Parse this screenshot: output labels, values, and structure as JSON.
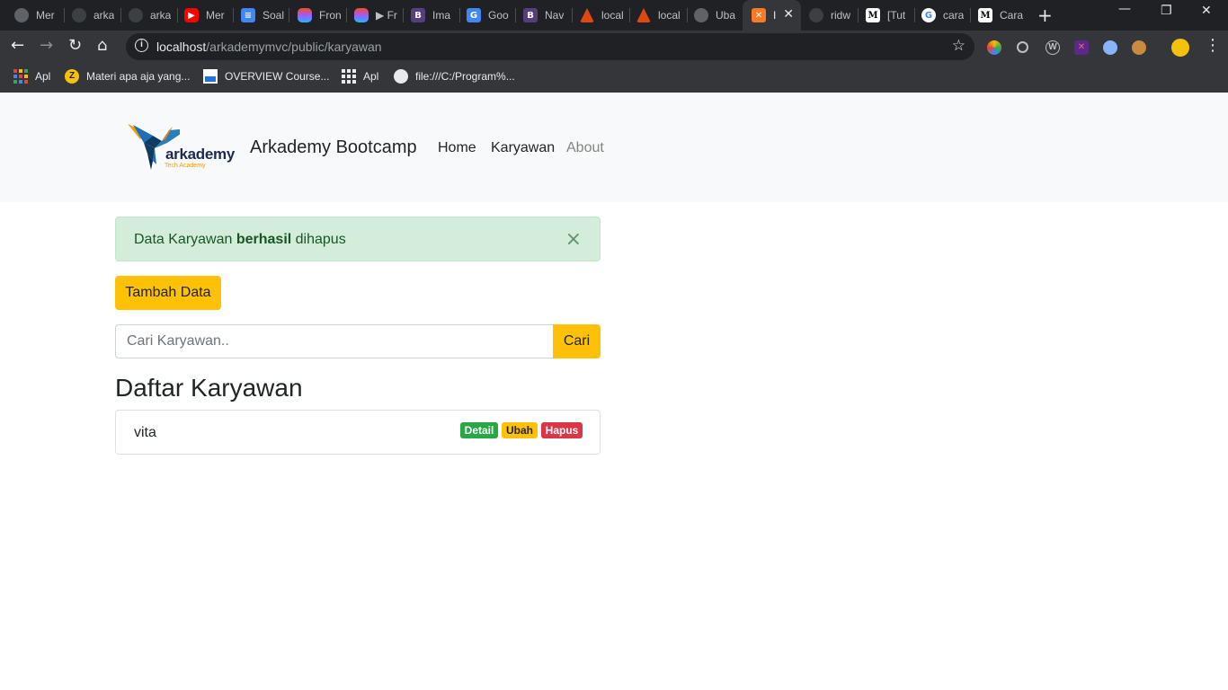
{
  "browser": {
    "tabs": [
      {
        "title": "Mer",
        "icon": "globe-icon"
      },
      {
        "title": "arka",
        "icon": "github-icon"
      },
      {
        "title": "arka",
        "icon": "github-icon"
      },
      {
        "title": "Mer",
        "icon": "youtube-icon"
      },
      {
        "title": "Soal",
        "icon": "docs-icon"
      },
      {
        "title": "Fron",
        "icon": "figma-icon"
      },
      {
        "title": "▶ Fr",
        "icon": "figma-icon"
      },
      {
        "title": "Ima",
        "icon": "bootstrap-icon"
      },
      {
        "title": "Goo",
        "icon": "translate-icon"
      },
      {
        "title": "Nav",
        "icon": "bootstrap-icon"
      },
      {
        "title": "local",
        "icon": "codeigniter-icon"
      },
      {
        "title": "local",
        "icon": "codeigniter-icon"
      },
      {
        "title": "Uba",
        "icon": "globe-icon"
      },
      {
        "title": "I",
        "icon": "xampp-icon"
      },
      {
        "title": "ridw",
        "icon": "github-icon"
      },
      {
        "title": "[Tut",
        "icon": "medium-icon"
      },
      {
        "title": "cara",
        "icon": "google-icon"
      },
      {
        "title": "Cara",
        "icon": "medium-icon"
      }
    ],
    "url_host": "localhost",
    "url_path": "/arkademymvc/public/karyawan",
    "bookmarks": [
      {
        "label": "Apl",
        "icon": "apps-icon"
      },
      {
        "label": "Materi apa aja yang...",
        "icon": "z-icon"
      },
      {
        "label": "OVERVIEW Course...",
        "icon": "course-icon"
      },
      {
        "label": "Apl",
        "icon": "apps-icon"
      },
      {
        "label": "file:///C:/Program%...",
        "icon": "globe-icon"
      }
    ]
  },
  "navbar": {
    "logo_text": "arkademy",
    "logo_subtext": "Tech Academy",
    "brand": "Arkademy Bootcamp",
    "links": [
      "Home",
      "Karyawan",
      "About"
    ]
  },
  "alert": {
    "prefix": "Data Karyawan ",
    "strong": "berhasil",
    "suffix": " dihapus",
    "close": "×"
  },
  "actions": {
    "add_label": "Tambah Data",
    "search_placeholder": "Cari Karyawan..",
    "search_button": "Cari"
  },
  "list": {
    "title": "Daftar Karyawan",
    "items": [
      {
        "name": "vita",
        "detail": "Detail",
        "edit": "Ubah",
        "delete": "Hapus"
      }
    ]
  },
  "colors": {
    "warning": "#ffc107",
    "success": "#28a745",
    "danger": "#dc3545",
    "alert_bg": "#d4edda"
  }
}
